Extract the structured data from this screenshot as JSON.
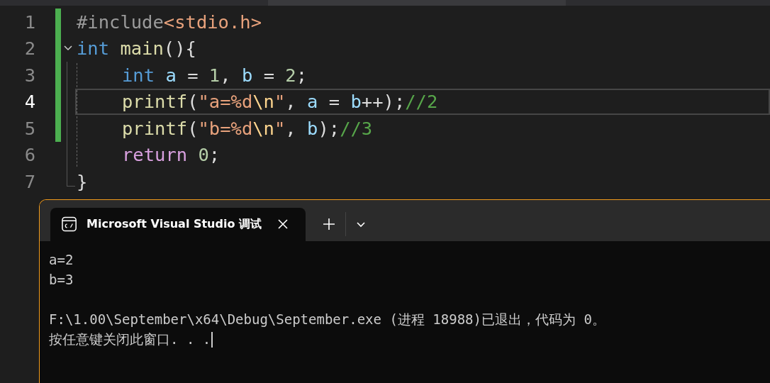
{
  "editor": {
    "lines": [
      {
        "number": "1",
        "changed": true,
        "current": false,
        "foldable": false,
        "indented": false,
        "tokens": [
          {
            "kind": "preproc",
            "text": "#include"
          },
          {
            "kind": "header",
            "text": "<stdio.h>"
          }
        ]
      },
      {
        "number": "2",
        "changed": true,
        "current": false,
        "foldable": true,
        "indented": false,
        "tokens": [
          {
            "kind": "keyword",
            "text": "int"
          },
          {
            "kind": "function",
            "text": " main"
          },
          {
            "kind": "punct",
            "text": "(){"
          }
        ]
      },
      {
        "number": "3",
        "changed": true,
        "current": false,
        "foldable": false,
        "indented": true,
        "tokens": [
          {
            "kind": "keyword",
            "text": "int"
          },
          {
            "kind": "variable",
            "text": " a"
          },
          {
            "kind": "punct",
            "text": " = "
          },
          {
            "kind": "number",
            "text": "1"
          },
          {
            "kind": "punct",
            "text": ", "
          },
          {
            "kind": "variable",
            "text": "b"
          },
          {
            "kind": "punct",
            "text": " = "
          },
          {
            "kind": "number",
            "text": "2"
          },
          {
            "kind": "punct",
            "text": ";"
          }
        ]
      },
      {
        "number": "4",
        "changed": true,
        "current": true,
        "foldable": false,
        "indented": true,
        "tokens": [
          {
            "kind": "function",
            "text": "printf"
          },
          {
            "kind": "punct",
            "text": "("
          },
          {
            "kind": "string",
            "text": "\"a=%d"
          },
          {
            "kind": "escape",
            "text": "\\n"
          },
          {
            "kind": "string",
            "text": "\""
          },
          {
            "kind": "punct",
            "text": ", "
          },
          {
            "kind": "variable",
            "text": "a"
          },
          {
            "kind": "punct",
            "text": " = "
          },
          {
            "kind": "variable",
            "text": "b"
          },
          {
            "kind": "punct",
            "text": "++);"
          },
          {
            "kind": "comment",
            "text": "//2"
          }
        ]
      },
      {
        "number": "5",
        "changed": true,
        "current": false,
        "foldable": false,
        "indented": true,
        "tokens": [
          {
            "kind": "function",
            "text": "printf"
          },
          {
            "kind": "punct",
            "text": "("
          },
          {
            "kind": "string",
            "text": "\"b=%d"
          },
          {
            "kind": "escape",
            "text": "\\n"
          },
          {
            "kind": "string",
            "text": "\""
          },
          {
            "kind": "punct",
            "text": ", "
          },
          {
            "kind": "variable",
            "text": "b"
          },
          {
            "kind": "punct",
            "text": ");"
          },
          {
            "kind": "comment",
            "text": "//3"
          }
        ]
      },
      {
        "number": "6",
        "changed": false,
        "current": false,
        "foldable": false,
        "indented": true,
        "tokens": [
          {
            "kind": "control",
            "text": "return"
          },
          {
            "kind": "number",
            "text": " 0"
          },
          {
            "kind": "punct",
            "text": ";"
          }
        ]
      },
      {
        "number": "7",
        "changed": false,
        "current": false,
        "foldable": false,
        "indented": false,
        "tokens": [
          {
            "kind": "punct",
            "text": "}"
          }
        ]
      }
    ]
  },
  "terminal": {
    "tab": {
      "title": "Microsoft Visual Studio 调试",
      "selected": true
    },
    "output": [
      {
        "lines": [
          "a=2",
          "b=3"
        ]
      },
      {
        "lines": [
          "F:\\1.00\\September\\x64\\Debug\\September.exe (进程 18988)已退出，代码为 0。",
          "按任意键关闭此窗口. . ."
        ]
      }
    ]
  }
}
